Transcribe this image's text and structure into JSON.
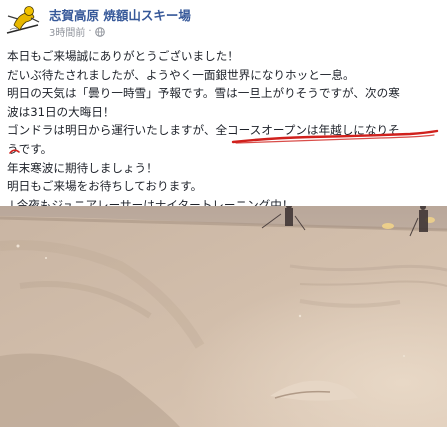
{
  "page": {
    "name": "志賀高原 焼額山スキー場",
    "timestamp": "3時間前",
    "timestamp_sep": "·"
  },
  "post": {
    "lines": [
      "本日もご来場誠にありがとうございました！",
      "だいぶ待たされましたが、ようやく一面銀世界になりホッと一息。",
      "明日の天気は「曇り一時雪」予報です。雪は一旦上がりそうですが、次の寒",
      "波は31日の大晦日！",
      "ゴンドラは明日から運行いたしますが、全コースオープンは年越しになりそ",
      "うです。",
      "年末寒波に期待しましょう！",
      "明日もご来場をお待ちしております。",
      "↓今夜もジュニアレーサーはナイタートレーニング中！"
    ]
  },
  "colors": {
    "page_name": "#365899",
    "meta": "#90949c",
    "text": "#1d2129",
    "annotation": "#d0201c"
  },
  "icons": {
    "avatar": "ski-mascot-icon",
    "privacy": "globe-icon"
  }
}
